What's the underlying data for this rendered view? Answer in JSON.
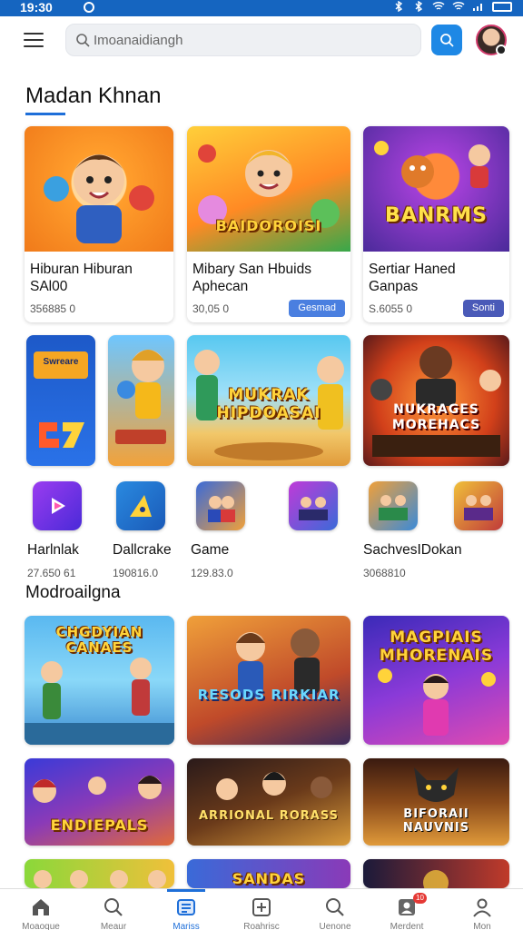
{
  "status_bar": {
    "time": "19:30"
  },
  "search": {
    "placeholder": "Imoanaidiangh"
  },
  "section1": {
    "title": "Madan Khnan"
  },
  "featured_cards": [
    {
      "title": "Hiburan Hiburan\nSAl00",
      "meta": "356885 0",
      "action": ""
    },
    {
      "title": "Mibary San Hbuids\nAphecan",
      "meta": "30,05 0",
      "action": "Gesmad",
      "action_color": "#4a7fe0",
      "thumb_label": "BAIDOROISI"
    },
    {
      "title": "Sertiar Haned\nGanpas",
      "meta": "S.6055 0",
      "action": "Sonti",
      "action_color": "#4a5ab8",
      "thumb_label": "BANRMS"
    }
  ],
  "banner_row": [
    {
      "label": "Swreare"
    },
    {
      "label": ""
    },
    {
      "label": "MUKRAK HIPDOASAI"
    },
    {
      "label": "NUKRAGES MOREHACS"
    }
  ],
  "apps": [
    {
      "name": "Harlnlak",
      "meta": "27.650 61"
    },
    {
      "name": "Dallcrake",
      "meta": "190816.0"
    },
    {
      "name": "Game",
      "meta": "129.83.0"
    },
    {
      "name": "",
      "meta": ""
    },
    {
      "name": "SachvesIDokan",
      "meta": "3068810"
    },
    {
      "name": "",
      "meta": ""
    }
  ],
  "section2": {
    "title": "Modroailgna"
  },
  "grid": [
    {
      "label": "CHGDYIAN CANAES"
    },
    {
      "label": "RESODS RIRKIAR"
    },
    {
      "label": "MAGPIAIS MHORENAIS"
    },
    {
      "label": "ENDIEPALS"
    },
    {
      "label": "ARRIONAL RORASS"
    },
    {
      "label": "BIFORAII NAUVNIS"
    },
    {
      "label": ""
    },
    {
      "label": "SANDAS"
    },
    {
      "label": ""
    }
  ],
  "bottom_nav": [
    {
      "label": "Moaoque",
      "icon": "home-icon"
    },
    {
      "label": "Meaur",
      "icon": "search-icon"
    },
    {
      "label": "Mariss",
      "icon": "library-icon",
      "active": true
    },
    {
      "label": "Roahrisc",
      "icon": "plus-box-icon"
    },
    {
      "label": "Uenone",
      "icon": "search-icon"
    },
    {
      "label": "Merdent",
      "icon": "profile-card-icon",
      "badge": "10"
    },
    {
      "label": "Mon",
      "icon": "user-icon"
    }
  ],
  "colors": {
    "accent": "#1e6fd9",
    "status_bar": "#1565c0",
    "search_button": "#1e88e5"
  }
}
